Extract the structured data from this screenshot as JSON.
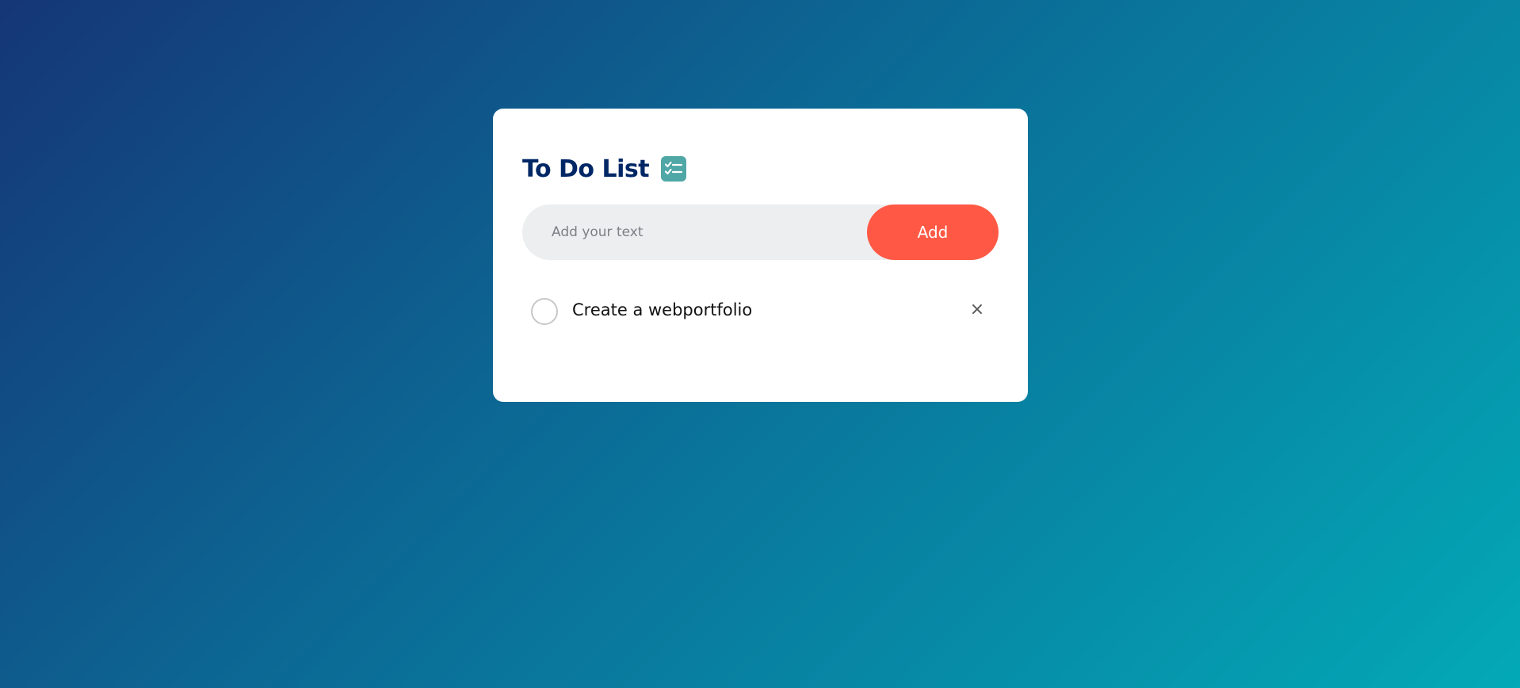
{
  "app": {
    "title": "To Do List",
    "title_icon": "checklist-icon"
  },
  "colors": {
    "background_start": "#153677",
    "background_end": "#03a9b7",
    "title": "#002765",
    "accent": "#ff5945",
    "input_bg": "#edeef0",
    "icon_bg": "#4fa7a6"
  },
  "input": {
    "placeholder": "Add your text",
    "value": ""
  },
  "add_button": {
    "label": "Add"
  },
  "tasks": [
    {
      "text": "Create a webportfolio",
      "checked": false,
      "close_symbol": "×"
    }
  ]
}
